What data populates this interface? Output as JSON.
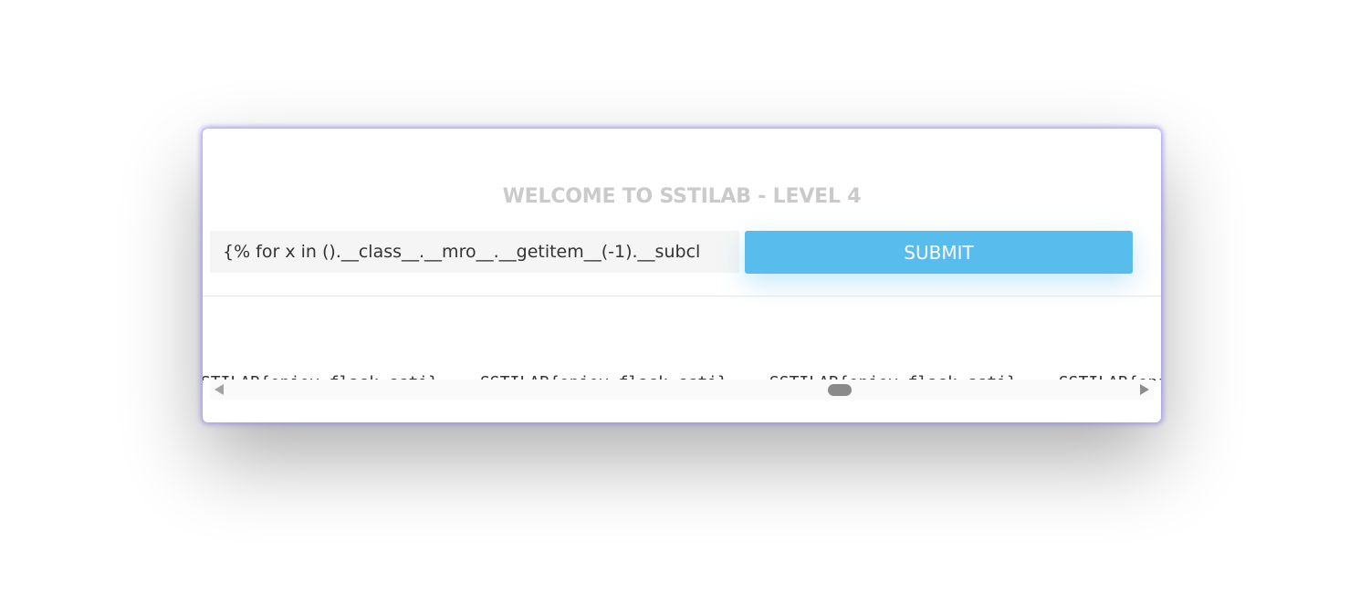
{
  "header": {
    "title": "WELCOME TO SSTILAB - LEVEL 4"
  },
  "form": {
    "input_value": "{% for x in ().__class__.__mro__.__getitem__(-1).__subcl",
    "submit_label": "SUBMIT"
  },
  "output": {
    "items": [
      "SSTILAB{enjoy_flask_ssti}",
      "SSTILAB{enjoy_flask_ssti}",
      "SSTILAB{enjoy_flask_ssti}",
      "SSTILAB{enjoy_flask_ssti}"
    ]
  },
  "scrollbar": {
    "horizontal_position": 0.67
  },
  "colors": {
    "accent": "#58bcec",
    "title_text": "#cacaca",
    "card_glow": "#8c82eb"
  }
}
